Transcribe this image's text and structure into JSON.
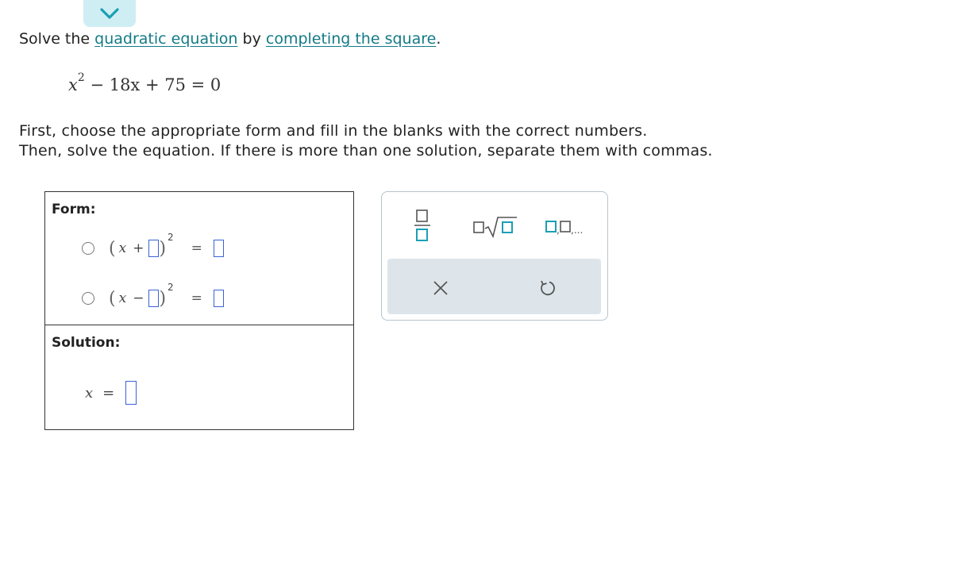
{
  "problem": {
    "prefix": "Solve the ",
    "link1": "quadratic equation",
    "middle": " by ",
    "link2": "completing the square",
    "suffix": "."
  },
  "equation": {
    "var": "x",
    "exponent": "2",
    "rest": " − 18x + 75 = 0"
  },
  "instructions": {
    "line1": "First, choose the appropriate form and fill in the blanks with the correct numbers.",
    "line2": "Then, solve the equation. If there is more than one solution, separate them with commas."
  },
  "form": {
    "label": "Form:",
    "options": [
      {
        "var": "x",
        "op": "+",
        "exponent": "2",
        "equals": "="
      },
      {
        "var": "x",
        "op": "−",
        "exponent": "2",
        "equals": "="
      }
    ]
  },
  "solution": {
    "label": "Solution:",
    "var": "x",
    "equals": "="
  },
  "toolbox": {
    "multi_label": "□,□,...",
    "icons": [
      "fraction-icon",
      "sqrt-icon",
      "list-icon",
      "clear-icon",
      "undo-icon"
    ]
  },
  "colors": {
    "link": "#137a87",
    "blank_border": "#3a63d6",
    "tool_accent": "#1a9fb5",
    "action_bar": "#dde5ea",
    "tab": "#cfeef4"
  }
}
